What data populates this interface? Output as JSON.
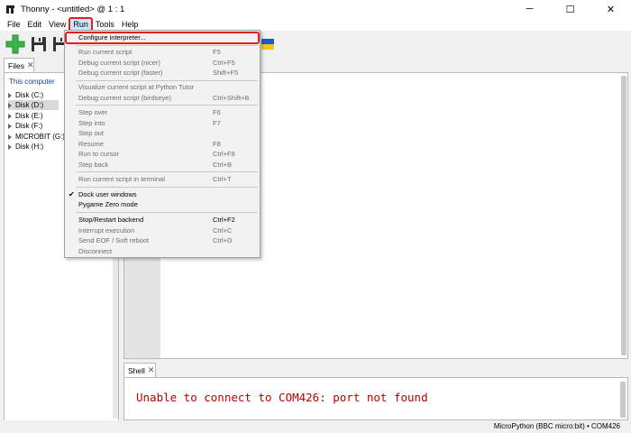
{
  "window": {
    "title": "Thonny  -  <untitled>  @  1 : 1",
    "minimize": "─",
    "maximize": "☐",
    "close": "✕"
  },
  "menubar": {
    "items": [
      "File",
      "Edit",
      "View",
      "Run",
      "Tools",
      "Help"
    ]
  },
  "files": {
    "tab_label": "Files",
    "tab_close": "✕",
    "header": "This computer",
    "items": [
      "Disk (C:)",
      "Disk (D:)",
      "Disk (E:)",
      "Disk (F:)",
      "MICROBIT (G:)",
      "Disk (H:)"
    ]
  },
  "shell": {
    "tab_label": "Shell",
    "tab_close": "✕",
    "message": "Unable to connect to COM426: port not found"
  },
  "status": {
    "text": "MicroPython (BBC micro:bit)  •  COM426"
  },
  "run_menu": {
    "items": [
      {
        "label": "Configure interpreter...",
        "shortcut": ""
      },
      {
        "label": "Run current script",
        "shortcut": "F5"
      },
      {
        "label": "Debug current script (nicer)",
        "shortcut": "Ctrl+F5"
      },
      {
        "label": "Debug current script (faster)",
        "shortcut": "Shift+F5"
      },
      {
        "label": "Visualize current script at Python Tutor",
        "shortcut": ""
      },
      {
        "label": "Debug current script (birdseye)",
        "shortcut": "Ctrl+Shift+B"
      },
      {
        "label": "Step over",
        "shortcut": "F6"
      },
      {
        "label": "Step into",
        "shortcut": "F7"
      },
      {
        "label": "Step out",
        "shortcut": ""
      },
      {
        "label": "Resume",
        "shortcut": "F8"
      },
      {
        "label": "Run to cursor",
        "shortcut": "Ctrl+F8"
      },
      {
        "label": "Step back",
        "shortcut": "Ctrl+B"
      },
      {
        "label": "Run current script in terminal",
        "shortcut": "Ctrl+T"
      },
      {
        "label": "Dock user windows",
        "shortcut": "",
        "check": "✔"
      },
      {
        "label": "Pygame Zero mode",
        "shortcut": ""
      },
      {
        "label": "Stop/Restart backend",
        "shortcut": "Ctrl+F2"
      },
      {
        "label": "Interrupt execution",
        "shortcut": "Ctrl+C"
      },
      {
        "label": "Send EOF / Soft reboot",
        "shortcut": "Ctrl+D"
      },
      {
        "label": "Disconnect",
        "shortcut": ""
      }
    ]
  },
  "colors": {
    "accent_blue": "#cce8ff",
    "highlight_red": "#e02020",
    "error_red": "#c00000",
    "tree_header_blue": "#1a3c9c"
  }
}
